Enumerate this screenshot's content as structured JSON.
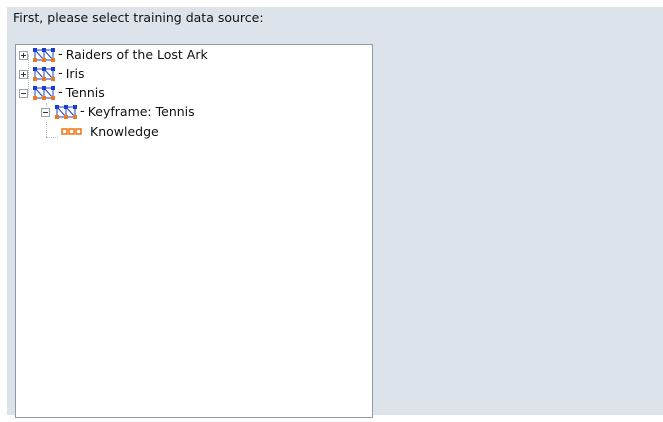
{
  "prompt": "First, please select training data source:",
  "tree": {
    "items": [
      {
        "label": "Raiders of the Lost Ark",
        "expanded": false,
        "icon": "network-icon"
      },
      {
        "label": "Iris",
        "expanded": false,
        "icon": "network-icon"
      },
      {
        "label": "Tennis",
        "expanded": true,
        "icon": "network-icon",
        "children": [
          {
            "label": "Keyframe: Tennis",
            "expanded": true,
            "icon": "network-icon",
            "children": [
              {
                "label": "Knowledge",
                "icon": "knowledge-icon"
              }
            ]
          }
        ]
      }
    ],
    "dash": "-"
  },
  "colors": {
    "panel_bg": "#dde3ea",
    "icon_blue": "#1a3fcf",
    "icon_orange": "#f07a1a"
  }
}
